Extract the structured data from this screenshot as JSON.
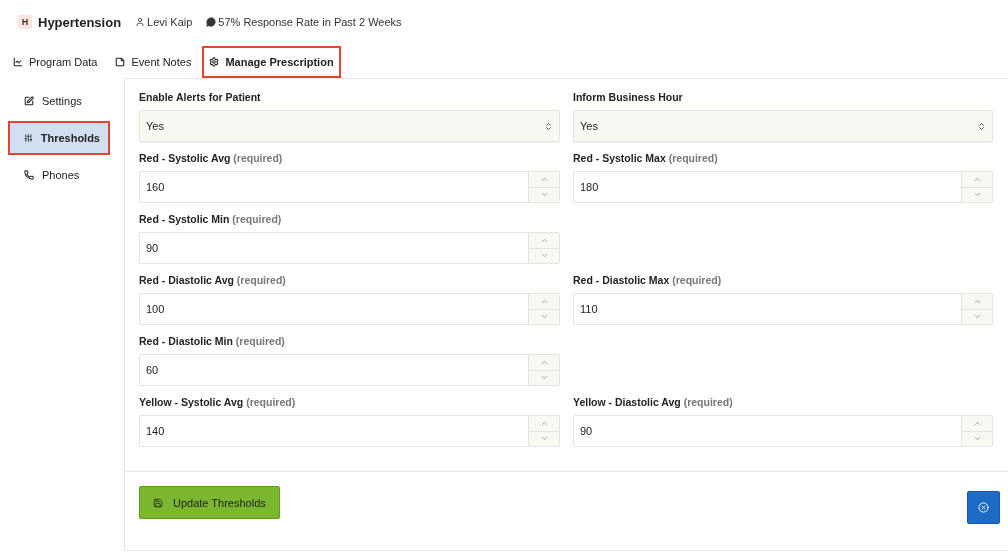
{
  "header": {
    "badge": "H",
    "title": "Hypertension",
    "user": "Levi Kaip",
    "response_rate": "57% Response Rate in Past 2 Weeks"
  },
  "tabs": [
    {
      "label": "Program Data",
      "selected": false
    },
    {
      "label": "Event Notes",
      "selected": false
    },
    {
      "label": "Manage Prescription",
      "selected": true
    }
  ],
  "sidebar": {
    "items": [
      {
        "label": "Settings",
        "selected": false
      },
      {
        "label": "Thresholds",
        "selected": true
      },
      {
        "label": "Phones",
        "selected": false
      }
    ]
  },
  "form": {
    "rows": [
      {
        "left": {
          "kind": "select",
          "label": "Enable Alerts for Patient",
          "value": "Yes"
        },
        "right": {
          "kind": "select",
          "label": "Inform Business Hour",
          "value": "Yes"
        }
      },
      {
        "left": {
          "kind": "number",
          "label": "Red - Systolic Avg",
          "hint": "(required)",
          "value": "160"
        },
        "right": {
          "kind": "number",
          "label": "Red - Systolic Max",
          "hint": "(required)",
          "value": "180"
        }
      },
      {
        "left": {
          "kind": "number",
          "label": "Red - Systolic Min",
          "hint": "(required)",
          "value": "90"
        }
      },
      {
        "left": {
          "kind": "number",
          "label": "Red - Diastolic Avg",
          "hint": "(required)",
          "value": "100"
        },
        "right": {
          "kind": "number",
          "label": "Red - Diastolic Max",
          "hint": "(required)",
          "value": "110"
        }
      },
      {
        "left": {
          "kind": "number",
          "label": "Red - Diastolic Min",
          "hint": "(required)",
          "value": "60"
        }
      },
      {
        "left": {
          "kind": "number",
          "label": "Yellow - Systolic Avg",
          "hint": "(required)",
          "value": "140"
        },
        "right": {
          "kind": "number",
          "label": "Yellow - Diastolic Avg",
          "hint": "(required)",
          "value": "90"
        }
      }
    ],
    "submit": "Update Thresholds"
  }
}
